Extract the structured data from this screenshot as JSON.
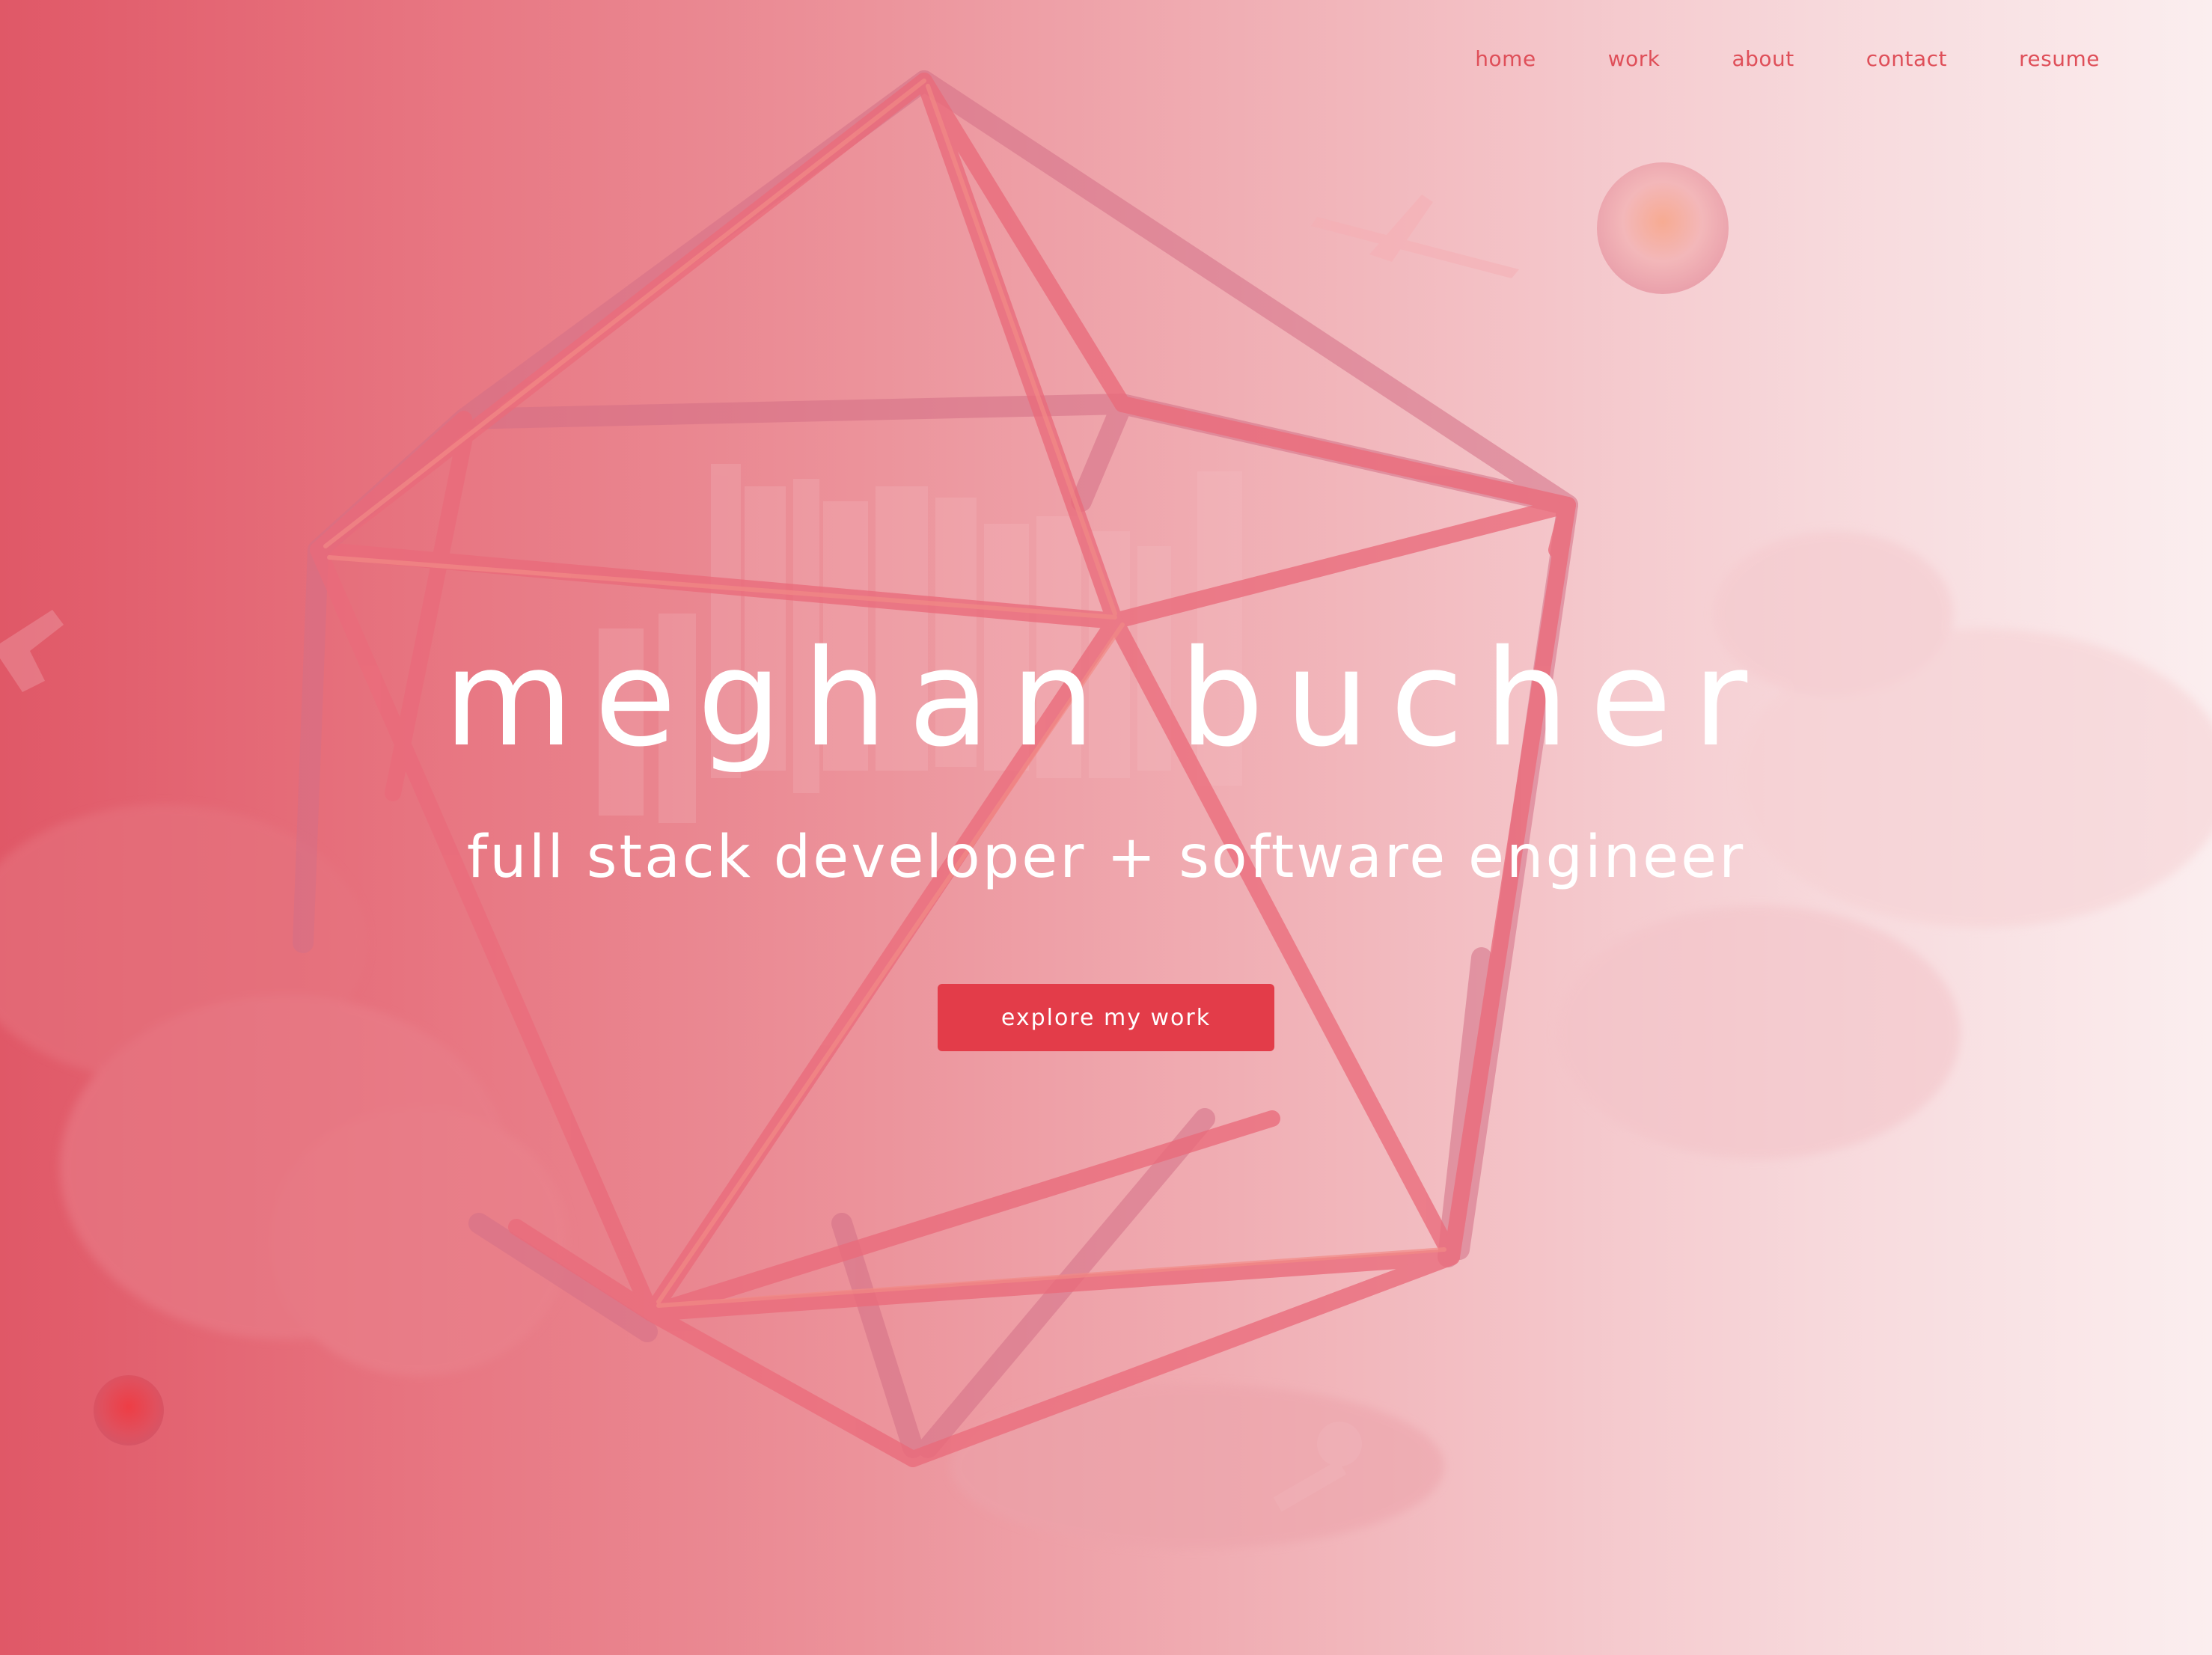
{
  "nav": {
    "items": [
      {
        "label": "home"
      },
      {
        "label": "work"
      },
      {
        "label": "about"
      },
      {
        "label": "contact"
      },
      {
        "label": "resume"
      }
    ]
  },
  "hero": {
    "title": "meghan bucher",
    "subtitle": "full stack developer + software engineer",
    "cta_label": "explore my work"
  },
  "colors": {
    "accent": "#e33c49",
    "nav_text": "#df4f59",
    "background_left": "#e05867",
    "background_right": "#fbeeef",
    "text_light": "#ffffff"
  }
}
